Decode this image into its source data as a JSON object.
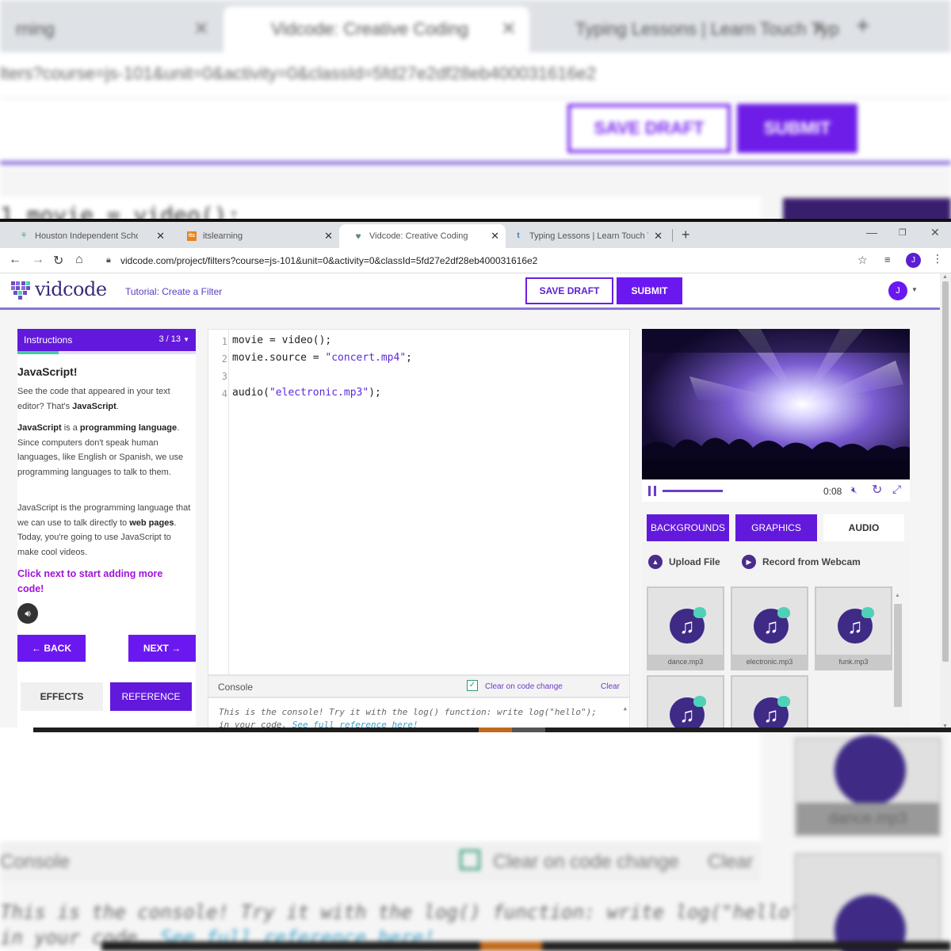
{
  "background": {
    "tab_left": "rning",
    "tab_active": "Vidcode: Creative Coding",
    "tab_right": "Typing Lessons | Learn Touch Typ",
    "url": "lters?course=js-101&unit=0&activity=0&classId=5fd27e2df28eb400031616e2",
    "save_draft": "SAVE DRAFT",
    "submit": "SUBMIT",
    "code_line": "1  movie = video();",
    "console_label": "Console",
    "clear_on_change": "Clear on code change",
    "clear": "Clear",
    "console_line1": "This is the console! Try it with the log() function: write log(\"hello\");",
    "console_line2_a": "in your code. ",
    "console_line2_link": "See full reference here!",
    "thumb_caption": "dance.mp3"
  },
  "browser": {
    "tabs": [
      {
        "title": "Houston Independent School Di",
        "favicon": "hisd-icon"
      },
      {
        "title": "itslearning",
        "favicon": "its-icon"
      },
      {
        "title": "Vidcode: Creative Coding",
        "favicon": "heart-icon"
      },
      {
        "title": "Typing Lessons | Learn Touch Typ",
        "favicon": "t-icon"
      }
    ],
    "active_tab": 2,
    "url": "vidcode.com/project/filters?course=js-101&unit=0&activity=0&classId=5fd27e2df28eb400031616e2",
    "profile_initial": "J"
  },
  "app": {
    "logo_text": "vidcode",
    "tutorial": "Tutorial: Create a Filter",
    "save_draft": "SAVE DRAFT",
    "submit": "SUBMIT",
    "user_initial": "J",
    "accent": "#6b18f0"
  },
  "instructions": {
    "header": "Instructions",
    "page": "3 / 13",
    "title": "JavaScript!",
    "p1_a": "See the code that appeared in your text editor? That's ",
    "p1_b": "JavaScript",
    "p1_c": ".",
    "p2_a": "JavaScript",
    "p2_b": " is a ",
    "p2_c": "programming language",
    "p2_d": ". Since computers don't speak human languages, like English or Spanish, we use programming languages to talk to them.",
    "p3_a": "JavaScript is the programming language that we can use to talk directly to ",
    "p3_b": "web pages",
    "p3_c": ". Today, you're going to use JavaScript to make cool videos.",
    "link": "Click next to start adding more code!",
    "back": "← BACK",
    "next": "NEXT →",
    "tab_effects": "EFFECTS",
    "tab_reference": "REFERENCE",
    "progress": 0.23
  },
  "editor": {
    "lines": [
      {
        "n": "1",
        "pre": "movie = video();",
        "str": "",
        "post": ""
      },
      {
        "n": "2",
        "pre": "movie.source = ",
        "str": "\"concert.mp4\"",
        "post": ";"
      },
      {
        "n": "3",
        "pre": "",
        "str": "",
        "post": ""
      },
      {
        "n": "4",
        "pre": "audio(",
        "str": "\"electronic.mp3\"",
        "post": ");"
      }
    ]
  },
  "console": {
    "label": "Console",
    "clear_on_change": "Clear on code change",
    "clear": "Clear",
    "line1": "This is the console! Try it with the log() function: write log(\"hello\");",
    "line2_a": "in your code. ",
    "line2_link": "See full reference here!"
  },
  "player": {
    "time": "0:08",
    "progress": 0.38
  },
  "media": {
    "tabs": [
      "BACKGROUNDS",
      "GRAPHICS",
      "AUDIO"
    ],
    "active": "AUDIO",
    "upload": "Upload File",
    "webcam": "Record from Webcam",
    "files": [
      "dance.mp3",
      "electronic.mp3",
      "funk.mp3"
    ]
  }
}
